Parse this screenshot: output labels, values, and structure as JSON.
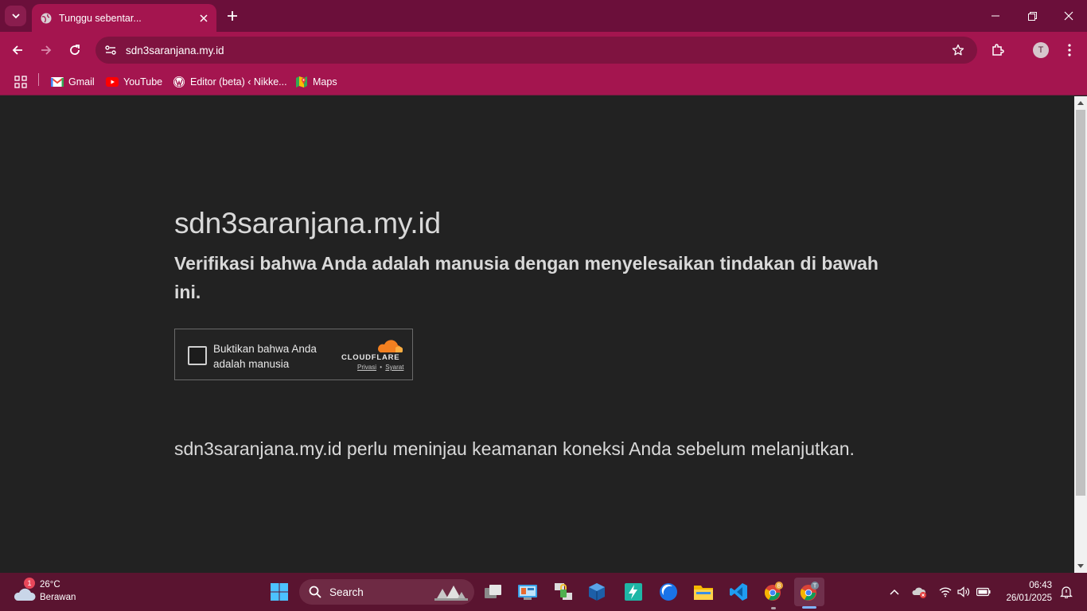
{
  "browser": {
    "tab": {
      "title": "Tunggu sebentar..."
    },
    "url": "sdn3saranjana.my.id",
    "profile_initial": "T",
    "bookmarks": [
      {
        "label": "Gmail",
        "icon": "gmail-icon"
      },
      {
        "label": "YouTube",
        "icon": "youtube-icon"
      },
      {
        "label": "Editor (beta) ‹ Nikke...",
        "icon": "wordpress-icon"
      },
      {
        "label": "Maps",
        "icon": "maps-icon"
      }
    ]
  },
  "page": {
    "site_title": "sdn3saranjana.my.id",
    "verify_text": "Verifikasi bahwa Anda adalah manusia dengan menyelesaikan tindakan di bawah ini.",
    "widget": {
      "checkbox_label": "Buktikan bahwa Anda adalah manusia",
      "brand": "CLOUDFLARE",
      "privacy_link": "Privasi",
      "separator": "•",
      "terms_link": "Syarat",
      "checked": false
    },
    "review_text": "sdn3saranjana.my.id perlu meninjau keamanan koneksi Anda sebelum melanjutkan."
  },
  "taskbar": {
    "weather": {
      "temperature": "26°C",
      "condition": "Berawan",
      "badge": "1"
    },
    "search_label": "Search",
    "clock": {
      "time": "06:43",
      "date": "26/01/2025"
    }
  },
  "colors": {
    "frame_dark": "#6b0f3a",
    "frame": "#a4154f",
    "omnibox": "#7f1340",
    "page_bg": "#222222",
    "cloudflare_orange": "#f38020"
  }
}
